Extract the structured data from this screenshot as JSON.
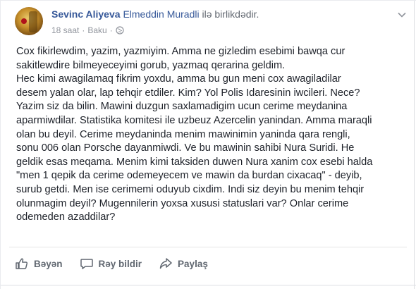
{
  "post": {
    "author_name": "Sevinc Aliyeva",
    "with_name": "Elmeddin Muradli",
    "with_text": "ilə birlikdədir.",
    "time": "18 saat",
    "separator": "·",
    "location": "Baku",
    "privacy_icon": "globe-icon",
    "menu_icon": "chevron-down-icon",
    "text": "Cox fikirlewdim, yazim, yazmiyim. Amma ne gizledim esebimi bawqa cur\nsakitlewdire bilmeyeceyimi gorub, yazmaq qerarina geldim.\nHec kimi awagilamaq fikrim yoxdu, amma bu gun meni cox awagiladilar\ndesem yalan olar, lap tehqir etdiler. Kim? Yol Polis Idaresinin iwcileri. Nece?\nYazim siz da bilin. Mawini duzgun saxlamadigim ucun cerime meydanina\naparmiwdilar. Statistika komitesi ile uzbeuz Azercelin yanindan. Amma maraqli\nolan bu deyil. Cerime meydaninda menim mawinimin yaninda qara rengli,\nsonu 006 olan Porsche dayanmiwdi. Ve bu mawinin sahibi Nura Suridi. He\ngeldik esas meqama. Menim kimi taksiden duwen Nura xanim cox esebi halda\n\"men 1 qepik da cerime odemeyecem ve mawin da burdan cixacaq\" - deyib,\nsurub getdi. Men ise cerimemi oduyub cixdim. Indi siz deyin bu menim tehqir\nolunmagim deyil? Mugennilerin yoxsa xususi statuslari var? Onlar cerime\nodemeden azaddilar?"
  },
  "actions": {
    "like_label": "Bəyən",
    "comment_label": "Rəy bildir",
    "share_label": "Paylaş"
  },
  "colors": {
    "link": "#365899",
    "meta": "#90949c",
    "action": "#606770"
  }
}
